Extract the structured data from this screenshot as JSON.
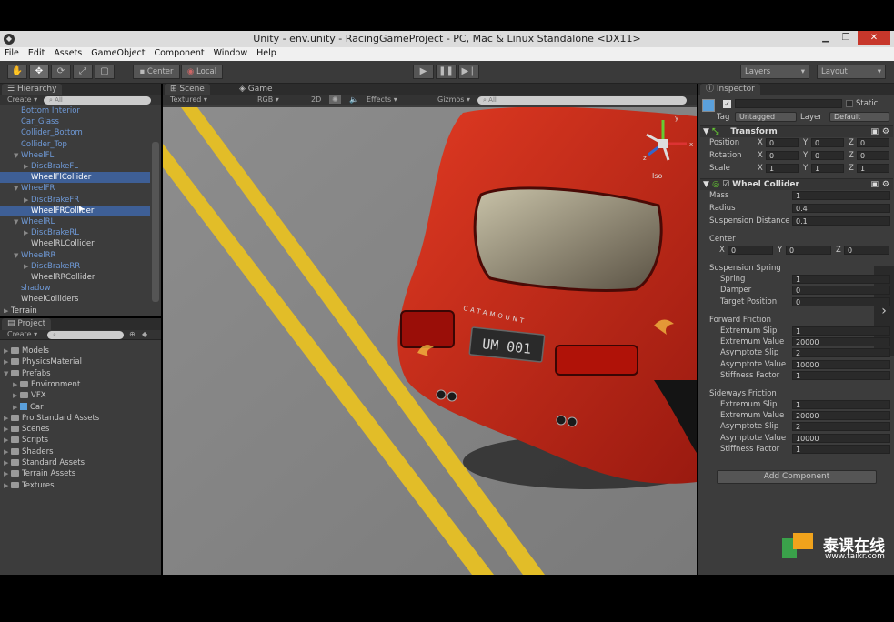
{
  "window": {
    "title": "Unity - env.unity - RacingGameProject - PC, Mac & Linux Standalone <DX11>",
    "minimize": "▁",
    "maximize": "❐",
    "close": "✕"
  },
  "menu": [
    "File",
    "Edit",
    "Assets",
    "GameObject",
    "Component",
    "Window",
    "Help"
  ],
  "toolbar": {
    "pivot_center": "Center",
    "pivot_local": "Local",
    "layers": "Layers",
    "layout": "Layout"
  },
  "hierarchy": {
    "tab": "Hierarchy",
    "create": "Create",
    "search_placeholder": "All",
    "items": [
      {
        "label": "Bottom Interior",
        "indent": 1,
        "color": "blue",
        "arrow": ""
      },
      {
        "label": "Car_Glass",
        "indent": 1,
        "color": "blue",
        "arrow": ""
      },
      {
        "label": "Collider_Bottom",
        "indent": 1,
        "color": "blue",
        "arrow": ""
      },
      {
        "label": "Collider_Top",
        "indent": 1,
        "color": "blue",
        "arrow": ""
      },
      {
        "label": "WheelFL",
        "indent": 1,
        "color": "blue",
        "arrow": "▼"
      },
      {
        "label": "DiscBrakeFL",
        "indent": 2,
        "color": "blue",
        "arrow": "▶"
      },
      {
        "label": "WheelFlCollider",
        "indent": 2,
        "color": "sel",
        "arrow": ""
      },
      {
        "label": "WheelFR",
        "indent": 1,
        "color": "blue",
        "arrow": "▼"
      },
      {
        "label": "DiscBrakeFR",
        "indent": 2,
        "color": "blue",
        "arrow": "▶"
      },
      {
        "label": "WheelFRCollider",
        "indent": 2,
        "color": "sel",
        "arrow": ""
      },
      {
        "label": "WheelRL",
        "indent": 1,
        "color": "blue",
        "arrow": "▼"
      },
      {
        "label": "DiscBrakeRL",
        "indent": 2,
        "color": "blue",
        "arrow": "▶"
      },
      {
        "label": "WheelRLCollider",
        "indent": 2,
        "color": "white",
        "arrow": ""
      },
      {
        "label": "WheelRR",
        "indent": 1,
        "color": "blue",
        "arrow": "▼"
      },
      {
        "label": "DiscBrakeRR",
        "indent": 2,
        "color": "blue",
        "arrow": "▶"
      },
      {
        "label": "WheelRRCollider",
        "indent": 2,
        "color": "white",
        "arrow": ""
      },
      {
        "label": "shadow",
        "indent": 1,
        "color": "blue",
        "arrow": ""
      },
      {
        "label": "WheelColliders",
        "indent": 1,
        "color": "white",
        "arrow": ""
      },
      {
        "label": "Terrain",
        "indent": 0,
        "color": "white",
        "arrow": "▶"
      }
    ]
  },
  "project": {
    "tab": "Project",
    "create": "Create",
    "items": [
      {
        "label": "Models",
        "indent": 0,
        "icon": "folder"
      },
      {
        "label": "PhysicsMaterial",
        "indent": 0,
        "icon": "folder"
      },
      {
        "label": "Prefabs",
        "indent": 0,
        "icon": "folder",
        "open": true
      },
      {
        "label": "Environment",
        "indent": 1,
        "icon": "folder"
      },
      {
        "label": "VFX",
        "indent": 1,
        "icon": "folder"
      },
      {
        "label": "Car",
        "indent": 1,
        "icon": "cube"
      },
      {
        "label": "Pro Standard Assets",
        "indent": 0,
        "icon": "folder"
      },
      {
        "label": "Scenes",
        "indent": 0,
        "icon": "folder"
      },
      {
        "label": "Scripts",
        "indent": 0,
        "icon": "folder"
      },
      {
        "label": "Shaders",
        "indent": 0,
        "icon": "folder"
      },
      {
        "label": "Standard Assets",
        "indent": 0,
        "icon": "folder"
      },
      {
        "label": "Terrain Assets",
        "indent": 0,
        "icon": "folder"
      },
      {
        "label": "Textures",
        "indent": 0,
        "icon": "folder"
      }
    ]
  },
  "scene": {
    "tab_scene": "Scene",
    "tab_game": "Game",
    "shading": "Textured",
    "render_mode": "RGB",
    "twod": "2D",
    "effects": "Effects",
    "gizmos": "Gizmos",
    "search_placeholder": "All",
    "iso_label": "Iso",
    "gizmo_axes": {
      "x": "x",
      "y": "y",
      "z": "z"
    },
    "plate": "UM 001",
    "badge": "CATAMOUNT"
  },
  "inspector": {
    "tab": "Inspector",
    "static_label": "Static",
    "tag_label": "Tag",
    "tag_value": "Untagged",
    "layer_label": "Layer",
    "layer_value": "Default",
    "transform": {
      "title": "Transform",
      "rows": [
        {
          "label": "Position",
          "x": "0",
          "y": "0",
          "z": "0"
        },
        {
          "label": "Rotation",
          "x": "0",
          "y": "0",
          "z": "0"
        },
        {
          "label": "Scale",
          "x": "1",
          "y": "1",
          "z": "1"
        }
      ]
    },
    "wheel_collider": {
      "title": "Wheel Collider",
      "mass_label": "Mass",
      "mass": "1",
      "radius_label": "Radius",
      "radius": "0.4",
      "susp_dist_label": "Suspension Distance",
      "susp_dist": "0.1",
      "center_label": "Center",
      "center": {
        "x": "0",
        "y": "0",
        "z": "0"
      },
      "spring_header": "Suspension Spring",
      "spring": [
        {
          "label": "Spring",
          "value": "1"
        },
        {
          "label": "Damper",
          "value": "0"
        },
        {
          "label": "Target Position",
          "value": "0"
        }
      ],
      "forward_header": "Forward Friction",
      "forward": [
        {
          "label": "Extremum Slip",
          "value": "1"
        },
        {
          "label": "Extremum Value",
          "value": "20000"
        },
        {
          "label": "Asymptote Slip",
          "value": "2"
        },
        {
          "label": "Asymptote Value",
          "value": "10000"
        },
        {
          "label": "Stiffness Factor",
          "value": "1"
        }
      ],
      "sideways_header": "Sideways Friction",
      "sideways": [
        {
          "label": "Extremum Slip",
          "value": "1"
        },
        {
          "label": "Extremum Value",
          "value": "20000"
        },
        {
          "label": "Asymptote Slip",
          "value": "2"
        },
        {
          "label": "Asymptote Value",
          "value": "10000"
        },
        {
          "label": "Stiffness Factor",
          "value": "1"
        }
      ]
    },
    "add_component": "Add Component"
  },
  "watermark": {
    "name": "泰课在线",
    "url": "www.taikr.com"
  },
  "colors": {
    "panel": "#3c3c3c",
    "selection": "#3e5f96",
    "prefab_text": "#6f9ad8",
    "close": "#c7372b",
    "car_red": "#c8281a",
    "road_line": "#e8c42a"
  }
}
